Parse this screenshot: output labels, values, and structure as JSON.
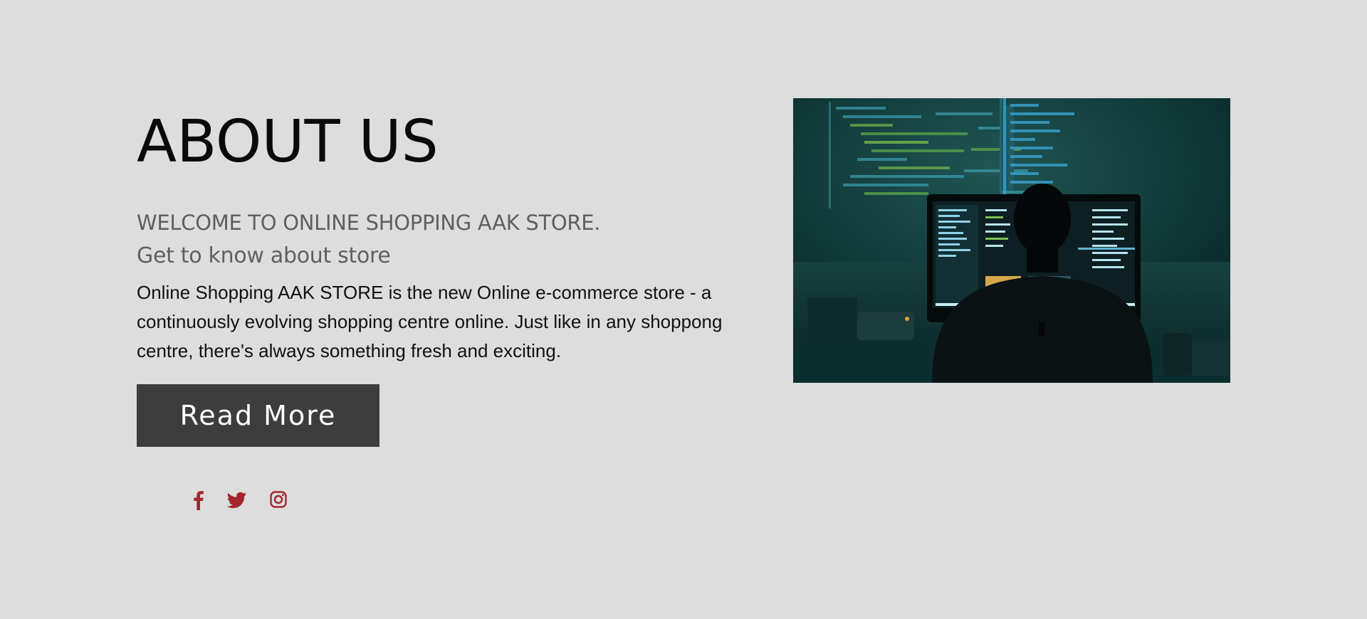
{
  "about": {
    "title": "ABOUT US",
    "welcome": "WELCOME TO ONLINE SHOPPING AAK STORE.",
    "subtitle": "Get to know about store",
    "description": "Online Shopping AAK STORE is the new Online e-commerce store - a continuously evolving shopping centre online. Just like in any shoppong centre, there's always something fresh and exciting.",
    "read_more_label": "Read More"
  },
  "social": {
    "icons": [
      "facebook-icon",
      "twitter-icon",
      "instagram-icon"
    ],
    "color": "#a4262c"
  },
  "colors": {
    "background": "#dddddd",
    "button": "#3d3d3d",
    "heading": "#0a0a0a",
    "subheading": "#5f5f5f"
  }
}
